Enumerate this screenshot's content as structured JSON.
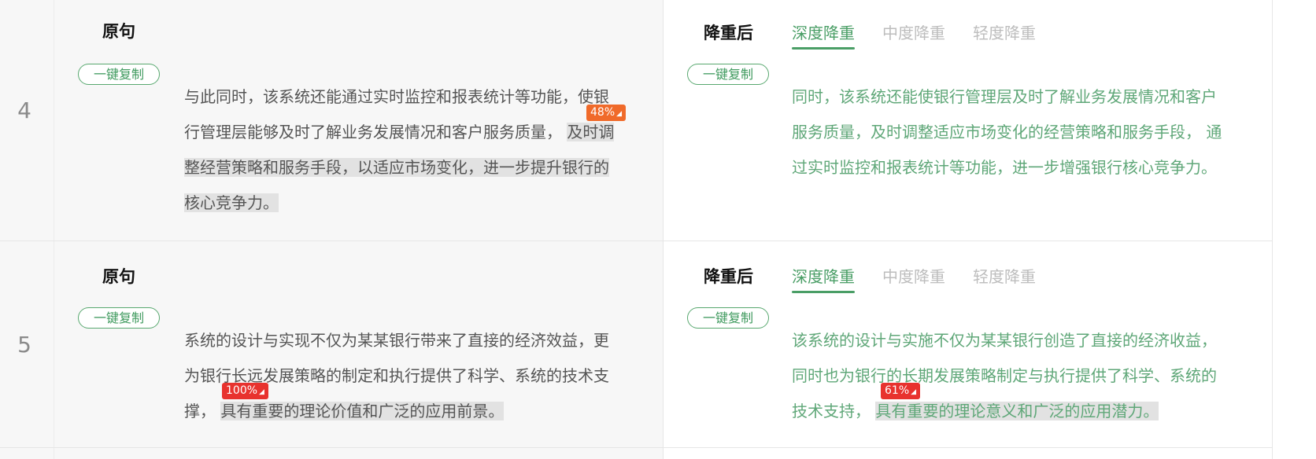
{
  "rows": [
    {
      "index": "4",
      "original": {
        "heading": "原句",
        "copy_label": "一键复制",
        "lines": [
          {
            "plain": "与此同时，该系统还能通过实时监控和报表统计等功能，使银",
            "hl": ""
          },
          {
            "plain": "行管理层能够及时了解业务发展情况和客户服务质量， ",
            "hl": "及时调"
          },
          {
            "plain": "",
            "hl": "整经营策略和服务手段，以适应市场变化，进一步提升银行的"
          },
          {
            "plain": "",
            "hl": "核心竞争力。"
          }
        ],
        "badge": "48%"
      },
      "rewrite": {
        "heading": "降重后",
        "copy_label": "一键复制",
        "tabs": [
          "深度降重",
          "中度降重",
          "轻度降重"
        ],
        "active_tab": "深度降重",
        "lines": [
          {
            "plain": "同时，该系统还能使银行管理层及时了解业务发展情况和客户",
            "hl": ""
          },
          {
            "plain": "服务质量，及时调整适应市场变化的经营策略和服务手段， 通",
            "hl": ""
          },
          {
            "plain": "过实时监控和报表统计等功能，进一步增强银行核心竞争力。",
            "hl": ""
          }
        ]
      }
    },
    {
      "index": "5",
      "original": {
        "heading": "原句",
        "copy_label": "一键复制",
        "lines": [
          {
            "plain": "系统的设计与实现不仅为某某银行带来了直接的经济效益，更",
            "hl": ""
          },
          {
            "plain": "为银行长远发展策略的制定和执行提供了科学、系统的技术支",
            "hl": ""
          },
          {
            "plain": "撑， ",
            "hl": "具有重要的理论价值和广泛的应用前景。"
          }
        ],
        "badge": "100%"
      },
      "rewrite": {
        "heading": "降重后",
        "copy_label": "一键复制",
        "tabs": [
          "深度降重",
          "中度降重",
          "轻度降重"
        ],
        "active_tab": "深度降重",
        "lines": [
          {
            "plain": "该系统的设计与实施不仅为某某银行创造了直接的经济收益，",
            "hl": ""
          },
          {
            "plain": "同时也为银行的长期发展策略制定与执行提供了科学、系统的",
            "hl": ""
          },
          {
            "plain": "技术支持， ",
            "hl": "具有重要的理论意义和广泛的应用潜力。"
          }
        ],
        "badge": "61%"
      }
    }
  ],
  "colors": {
    "accent_green": "#4a9e66",
    "badge_orange": "#f06a2a",
    "badge_red": "#e8322e",
    "highlight_gray": "#e2e2e2"
  },
  "icons": {
    "badge_corner": "triangle-corner-icon"
  }
}
